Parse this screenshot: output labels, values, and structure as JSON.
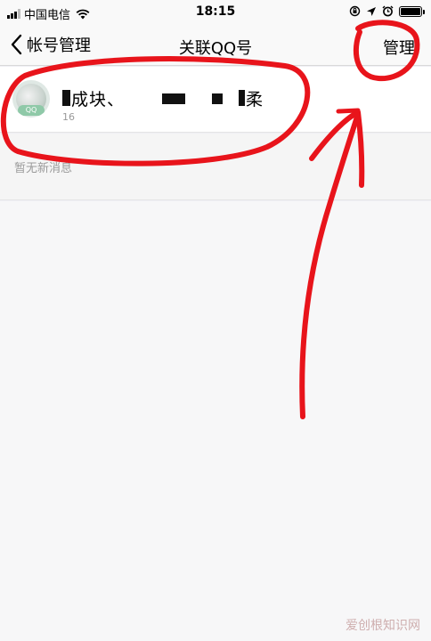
{
  "status_bar": {
    "carrier": "中国电信",
    "time": "18:15",
    "battery_level": 1.0,
    "icons": [
      "signal-icon",
      "wifi-icon",
      "lock-rotation-icon",
      "location-icon",
      "alarm-icon",
      "battery-icon"
    ]
  },
  "nav": {
    "back_label": "帐号管理",
    "title": "关联QQ号",
    "manage_label": "管理"
  },
  "account": {
    "avatar_badge": "QQ",
    "name_visible_a": "成块、",
    "name_visible_b": "柔",
    "sub_visible": "16"
  },
  "empty": {
    "message": "暂无新消息"
  },
  "watermark": "爱创根知识网",
  "colors": {
    "annotation": "#e8141b",
    "background": "#efeff4",
    "nav_bg": "#f9f9f9"
  }
}
